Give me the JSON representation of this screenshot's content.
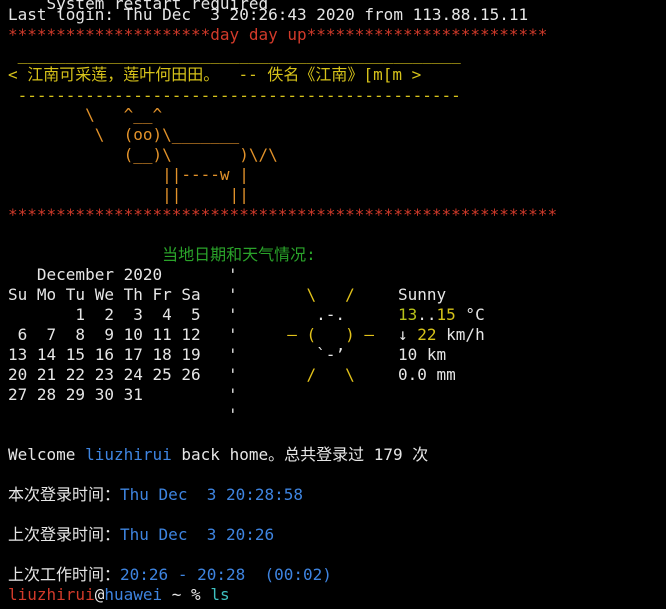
{
  "terminal": {
    "lines": {
      "top_partial": "    System restart required",
      "last_login": "Last login: Thu Dec  3 20:26:43 2020 from 113.88.15.11",
      "banner_top": "*********************day day up*************************",
      "cowsay_top": " ______________________________________________",
      "cowsay_text": "< 江南可采莲，莲叶何田田。  -- 佚名《江南》[m[m >",
      "cowsay_bottom": " ----------------------------------------------",
      "cow_1": "        \\   ^__^",
      "cow_2": "         \\  (oo)\\_______",
      "cow_3": "            (__)\\       )\\/\\",
      "cow_4": "                ||----w |",
      "cow_5": "                ||     ||",
      "banner_bottom": "*********************************************************",
      "weather_title": "                当地日期和天气情况:"
    },
    "calendar": {
      "month": "   December 2020",
      "weekdays": "Su Mo Tu We Th Fr Sa",
      "rows": [
        "       1  2  3  4  5",
        " 6  7  8  9 10 11 12",
        "13 14 15 16 17 18 19",
        "20 21 22 23 24 25 26",
        "27 28 29 30 31"
      ]
    },
    "weather": {
      "art": [
        "    \\   /   ",
        "     .-.    ",
        "  ― (   ) ― ",
        "     `-’    ",
        "    /   \\   "
      ],
      "condition": "Sunny",
      "temp_low": "13",
      "temp_sep": "..",
      "temp_high": "15",
      "temp_unit": " °C",
      "wind_arrow": "↓ ",
      "wind_speed": "22",
      "wind_unit": " km/h",
      "visibility": "10 km",
      "precipitation": "0.0 mm"
    },
    "welcome": {
      "prefix": "Welcome ",
      "user": "liuzhirui",
      "suffix": " back home。总共登录过 179 次"
    },
    "this_login": {
      "label": "本次登录时间：",
      "value": "Thu Dec  3 20:28:58"
    },
    "last_login_cn": {
      "label": "上次登录时间：",
      "value": "Thu Dec  3 20:26"
    },
    "last_work": {
      "label": "上次工作时间：",
      "value": "20:26 - 20:28  (00:02)"
    },
    "prompt": {
      "user": "liuzhirui",
      "at": "@",
      "host": "huawei",
      "path": " ~ % ",
      "command": "ls"
    },
    "colors": {
      "background": "#000000",
      "red": "#d23a2a",
      "yellow": "#d6c21a",
      "orange": "#e2922a",
      "green": "#2aa32a",
      "blue": "#3e84e0"
    }
  }
}
